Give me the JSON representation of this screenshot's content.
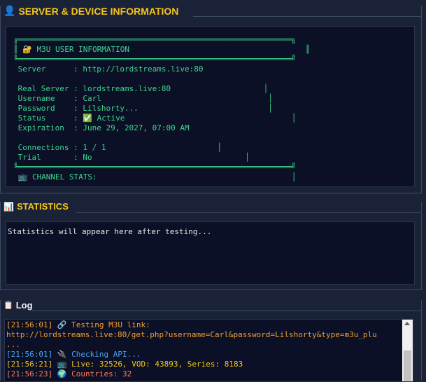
{
  "server_section": {
    "title": "SERVER & DEVICE INFORMATION",
    "info_lines": [
      "╔═══════════════════════════════════════════════════════════╗",
      "║ 🔐 M3U USER INFORMATION                                      ║",
      "╚═══════════════════════════════════════════════════════════╝",
      " Server      : http://lordstreams.live:80",
      "",
      " Real Server : lordstreams.live:80                    │",
      " Username    : Carl                                    │",
      " Password    : Lilshorty...                            │",
      " Status      : ✅ Active                                    │",
      " Expiration  : June 29, 2027, 07:00 AM",
      "",
      " Connections : 1 / 1                        │",
      " Trial       : No                                 │",
      "╚═══════════════════════════════════════════════════════════╝",
      " 📺 CHANNEL STATS:                                          │"
    ]
  },
  "statistics_section": {
    "title": "STATISTICS",
    "placeholder": "Statistics will appear here after testing..."
  },
  "log_section": {
    "title": "Log",
    "entries": [
      {
        "text": "[21:56:01] 🔗 Testing M3U link:",
        "color": "#f0a030"
      },
      {
        "text": "http://lordstreams.live:80/get.php?username=Carl&password=Lilshorty&type=m3u_plu",
        "color": "#f0a030"
      },
      {
        "text": "...",
        "color": "#f0a030"
      },
      {
        "text": "[21:56:01] 🔌 Checking API...",
        "color": "#4aa3f0"
      },
      {
        "text": "[21:56:21] 📺 Live: 32526, VOD: 43893, Series: 8183",
        "color": "#f5c518"
      },
      {
        "text": "[21:56:23] 🌍 Countries: 32",
        "color": "#ff7a5c"
      }
    ]
  },
  "colors": {
    "accent": "#f5c518",
    "info_text": "#3dd68c",
    "panel_bg": "#0b1026",
    "window_bg": "#1a2238"
  }
}
